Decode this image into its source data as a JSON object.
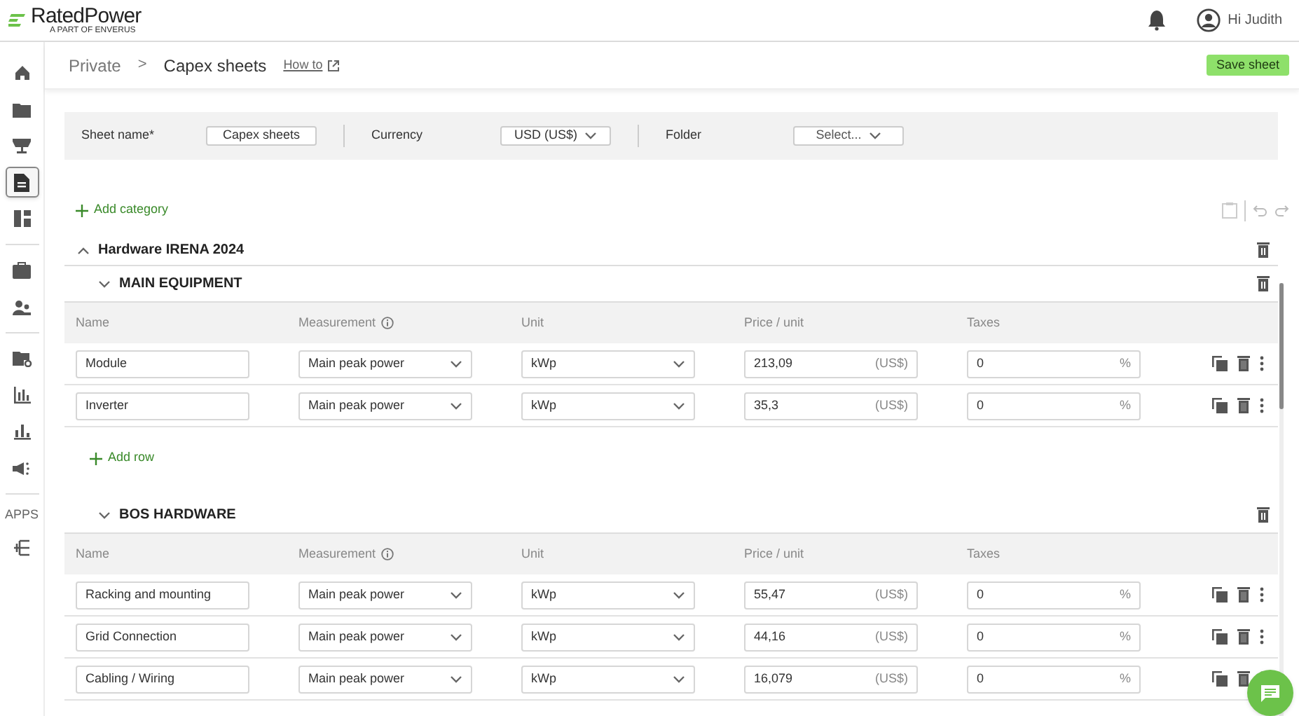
{
  "header": {
    "logo": "RatedPower",
    "logo_tagline": "A PART OF ENVERUS",
    "greeting": "Hi Judith"
  },
  "sidebar": {
    "items": [
      {
        "kind": "home",
        "selected": false
      },
      {
        "kind": "folder",
        "selected": false
      },
      {
        "kind": "presentation",
        "selected": false
      },
      {
        "kind": "document",
        "selected": true
      },
      {
        "kind": "dashboard",
        "selected": false
      },
      {
        "kind": "divider"
      },
      {
        "kind": "briefcase",
        "selected": false
      },
      {
        "kind": "people",
        "selected": false
      },
      {
        "kind": "divider"
      },
      {
        "kind": "folder-gear",
        "selected": false
      },
      {
        "kind": "bar-chart",
        "selected": false
      },
      {
        "kind": "column-chart",
        "selected": false
      },
      {
        "kind": "megaphone",
        "selected": false
      },
      {
        "kind": "divider"
      },
      {
        "kind": "label",
        "text": "APPS"
      },
      {
        "kind": "app",
        "selected": false
      }
    ]
  },
  "breadcrumb": {
    "items": [
      "Private",
      "Capex sheets"
    ],
    "separator": ">",
    "help_link": "How to"
  },
  "save_button": "Save sheet",
  "settings": {
    "sheet_name_label": "Sheet name*",
    "sheet_name_value": "Capex sheets",
    "currency_label": "Currency",
    "currency_value": "USD (US$)",
    "folder_label": "Folder",
    "folder_placeholder": "Select..."
  },
  "add_category": "Add category",
  "categories": [
    {
      "title": "Hardware IRENA 2024",
      "expanded": true,
      "groups": [
        {
          "title": "MAIN EQUIPMENT",
          "expanded": true,
          "columns": [
            "Name",
            "Measurement",
            "Unit",
            "Price / unit",
            "Taxes"
          ],
          "rows": [
            {
              "name": "Module",
              "measurement": "Main peak power",
              "unit": "kWp",
              "price": "213,09",
              "currency": "(US$)",
              "taxes": "0",
              "tax_unit": "%"
            },
            {
              "name": "Inverter",
              "measurement": "Main peak power",
              "unit": "kWp",
              "price": "35,3",
              "currency": "(US$)",
              "taxes": "0",
              "tax_unit": "%"
            }
          ],
          "add_row": "Add row"
        },
        {
          "title": "BOS HARDWARE",
          "expanded": true,
          "columns": [
            "Name",
            "Measurement",
            "Unit",
            "Price / unit",
            "Taxes"
          ],
          "rows": [
            {
              "name": "Racking and mounting",
              "measurement": "Main peak power",
              "unit": "kWp",
              "price": "55,47",
              "currency": "(US$)",
              "taxes": "0",
              "tax_unit": "%"
            },
            {
              "name": "Grid Connection",
              "measurement": "Main peak power",
              "unit": "kWp",
              "price": "44,16",
              "currency": "(US$)",
              "taxes": "0",
              "tax_unit": "%"
            },
            {
              "name": "Cabling / Wiring",
              "measurement": "Main peak power",
              "unit": "kWp",
              "price": "16,079",
              "currency": "(US$)",
              "taxes": "0",
              "tax_unit": "%"
            }
          ]
        }
      ]
    }
  ]
}
